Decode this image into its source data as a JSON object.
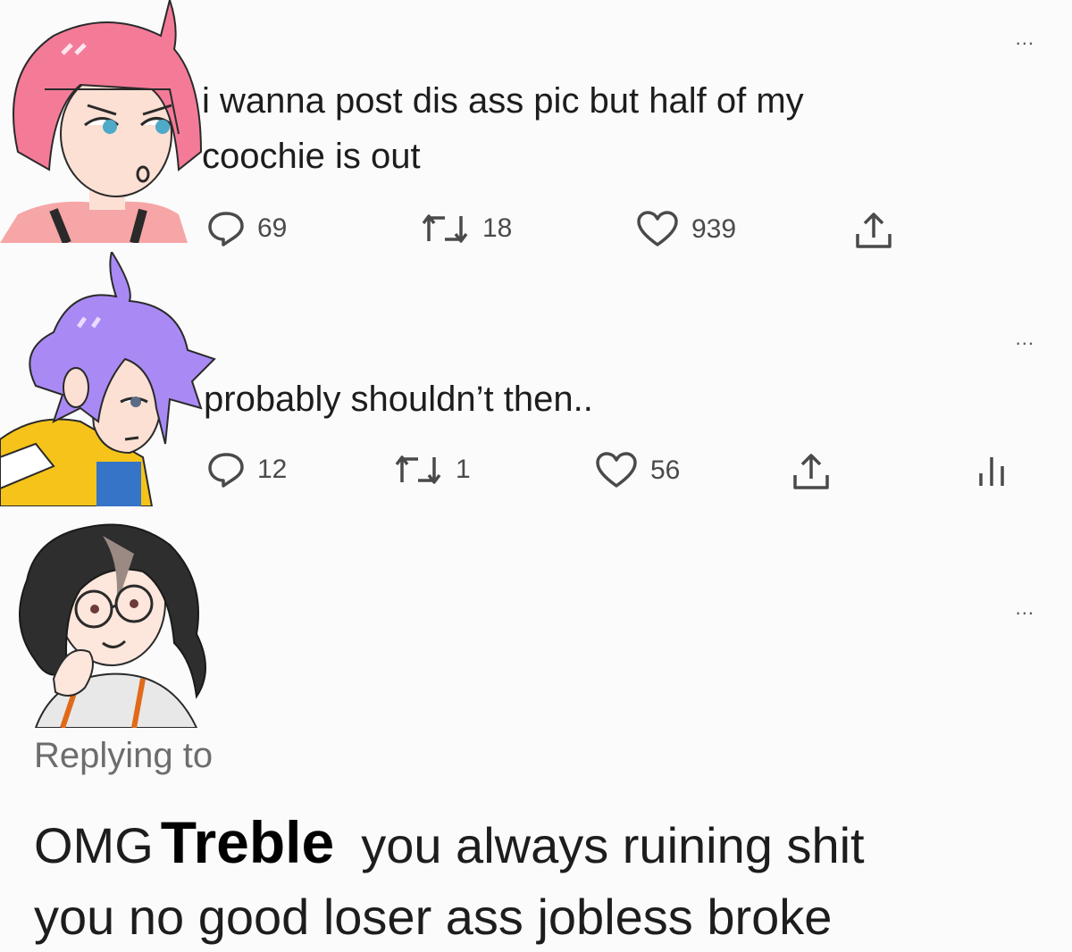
{
  "tweets": [
    {
      "text_lines": [
        "i wanna post dis ass pic but half of my",
        "coochie is out"
      ],
      "replies": "69",
      "retweets": "18",
      "likes": "939",
      "more": "..."
    },
    {
      "text_lines": [
        "probably shouldn’t then.."
      ],
      "replies": "12",
      "retweets": "1",
      "likes": "56",
      "more": "..."
    },
    {
      "more": "...",
      "replying_to": "Replying to",
      "reply_prefix": "OMG",
      "reply_name": "Treble",
      "reply_suffix": "you always ruining shit",
      "reply_line2": "you no good loser ass jobless broke"
    }
  ],
  "icons": [
    "reply-icon",
    "retweet-icon",
    "like-icon",
    "share-icon",
    "analytics-icon",
    "more-icon"
  ],
  "colors": {
    "pink_hair": "#f47b98",
    "purple_hair": "#a98af5",
    "dark_hair": "#2e2e2e",
    "yellow_jacket": "#f5c319"
  }
}
